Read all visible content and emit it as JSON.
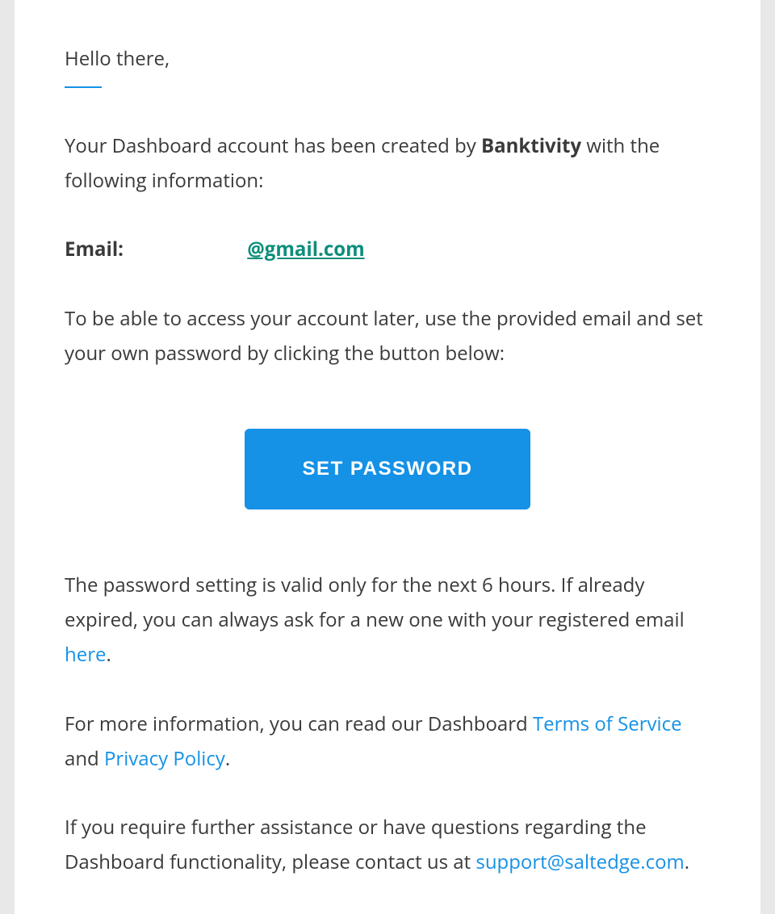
{
  "greeting": "Hello there,",
  "intro": {
    "before": "Your Dashboard account has been created by ",
    "company": "Banktivity",
    "after": " with the following information:"
  },
  "email_field": {
    "label": "Email:",
    "value": "@gmail.com"
  },
  "instructions": "To be able to access your account later, use the provided email and set your own password by clicking the button below:",
  "button_label": "SET PASSWORD",
  "expiry": {
    "before": "The password setting is valid only for the next 6 hours. If already expired, you can always ask for a new one with your registered email ",
    "link": "here",
    "after": "."
  },
  "more_info": {
    "before": "For more information, you can read our Dashboard ",
    "tos_link": "Terms of Service",
    "middle": " and ",
    "privacy_link": "Privacy Policy",
    "after": "."
  },
  "assistance": {
    "before": "If you require further assistance or have questions regarding the Dashboard functionality, please contact us at ",
    "support_email": "support@saltedge.com",
    "after": "."
  }
}
